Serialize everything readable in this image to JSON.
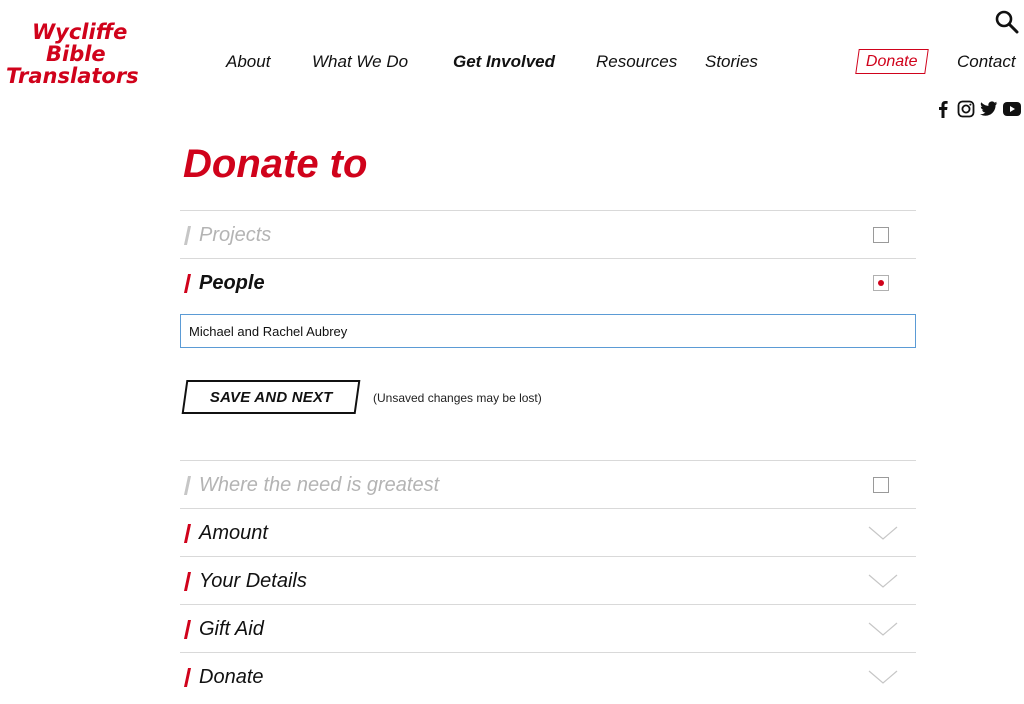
{
  "logo": {
    "line1": "Wycliffe",
    "line2": "Bible",
    "line3": "Translators"
  },
  "nav": {
    "items": [
      "About",
      "What We Do",
      "Get Involved",
      "Resources",
      "Stories"
    ],
    "donate": "Donate",
    "contact": "Contact"
  },
  "icons": {
    "search": "search-icon",
    "social": [
      "facebook-icon",
      "instagram-icon",
      "twitter-icon",
      "youtube-icon"
    ]
  },
  "colors": {
    "accent": "#d0021b",
    "focus": "#5b9bd5",
    "muted": "#b4b4b4"
  },
  "page": {
    "title": "Donate to"
  },
  "options": {
    "projects": {
      "label": "Projects",
      "checked": false
    },
    "people": {
      "label": "People",
      "checked": true
    },
    "need": {
      "label": "Where the need is greatest",
      "checked": false
    }
  },
  "people_input": {
    "value": "Michael and Rachel Aubrey"
  },
  "save": {
    "label": "SAVE AND NEXT",
    "note": "(Unsaved changes may be lost)"
  },
  "steps": [
    "Amount",
    "Your Details",
    "Gift Aid",
    "Donate"
  ]
}
